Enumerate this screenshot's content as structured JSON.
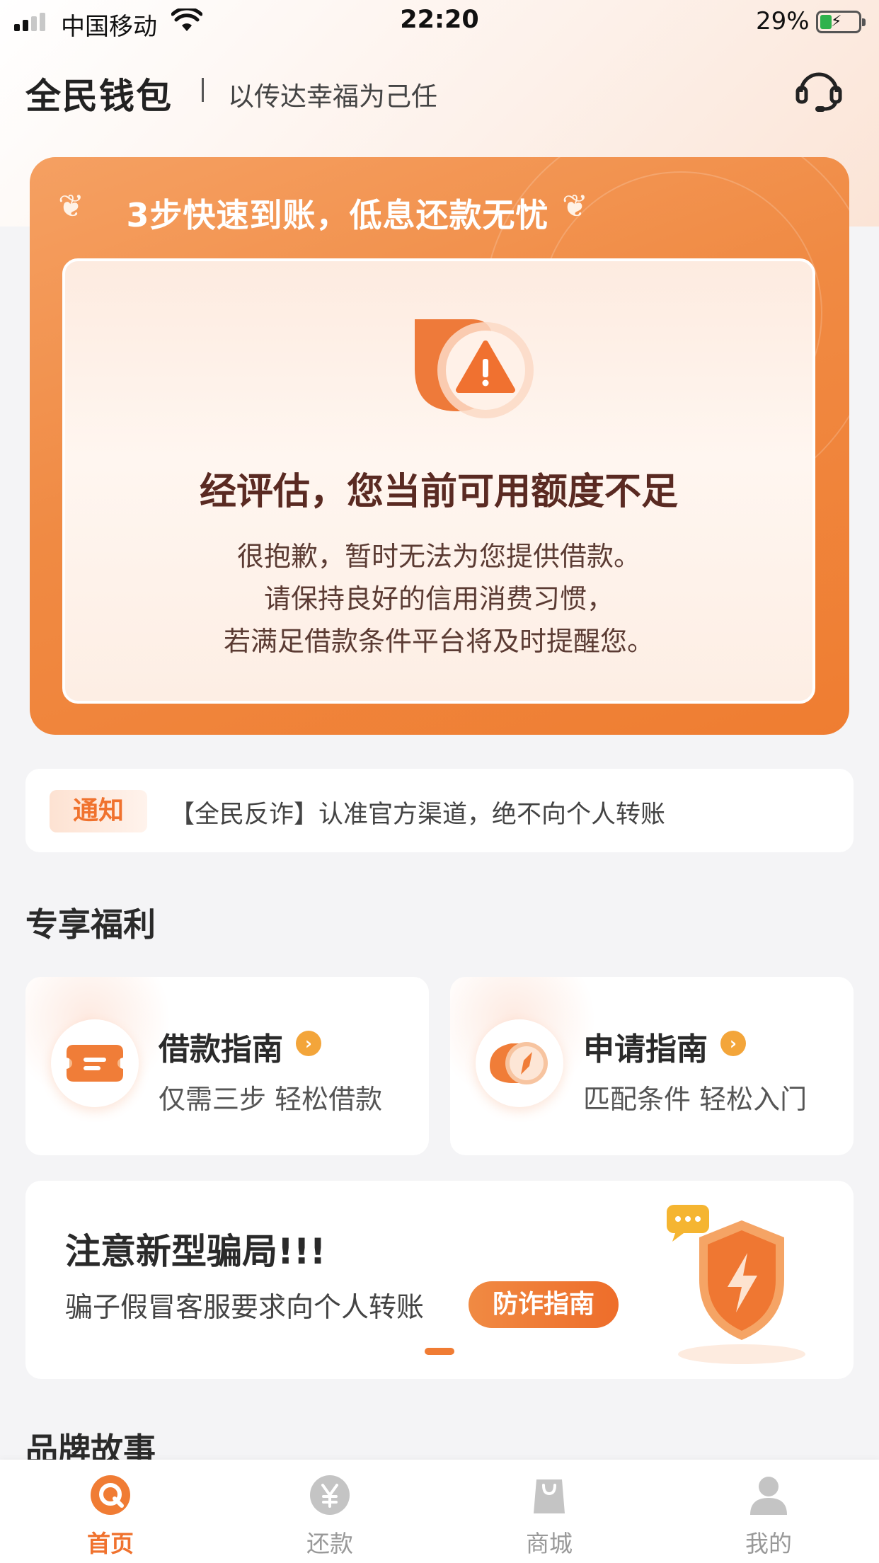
{
  "status_bar": {
    "carrier": "中国移动",
    "time": "22:20",
    "battery": "29%"
  },
  "header": {
    "app_name": "全民钱包",
    "slogan": "以传达幸福为己任",
    "support_icon": "headset-icon"
  },
  "hero": {
    "title": "3步快速到账，低息还款无忧",
    "warning_title": "经评估，您当前可用额度不足",
    "lines": [
      "很抱歉，暂时无法为您提供借款。",
      "请保持良好的信用消费习惯，",
      "若满足借款条件平台将及时提醒您。"
    ]
  },
  "notice": {
    "tag": "通知",
    "text": "【全民反诈】认准官方渠道，绝不向个人转账"
  },
  "benefits": {
    "section_title": "专享福利",
    "items": [
      {
        "title": "借款指南",
        "subtitle": "仅需三步 轻松借款",
        "icon": "ticket-icon"
      },
      {
        "title": "申请指南",
        "subtitle": "匹配条件 轻松入门",
        "icon": "compass-icon"
      }
    ]
  },
  "fraud": {
    "title": "注意新型骗局!!!",
    "subtitle": "骗子假冒客服要求向个人转账",
    "button": "防诈指南"
  },
  "brand": {
    "section_title": "品牌故事"
  },
  "tabbar": {
    "items": [
      {
        "label": "首页",
        "icon": "home-icon",
        "active": true
      },
      {
        "label": "还款",
        "icon": "yen-icon",
        "active": false
      },
      {
        "label": "商城",
        "icon": "shopping-bag-icon",
        "active": false
      },
      {
        "label": "我的",
        "icon": "user-icon",
        "active": false
      }
    ]
  },
  "colors": {
    "accent": "#f07c34",
    "accent_dark": "#ee6d2a",
    "inactive": "#c4c4c4"
  }
}
